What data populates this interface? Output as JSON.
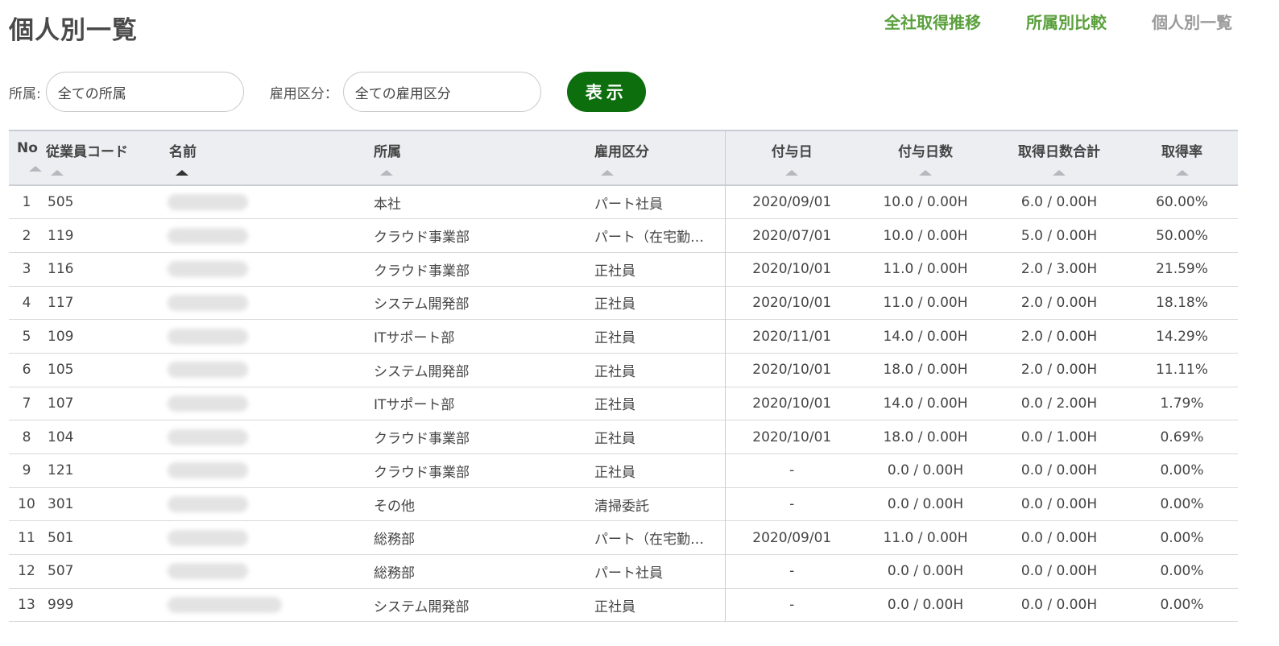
{
  "header": {
    "title": "個人別一覧",
    "nav": [
      {
        "label": "全社取得推移",
        "current": false
      },
      {
        "label": "所属別比較",
        "current": false
      },
      {
        "label": "個人別一覧",
        "current": true
      }
    ]
  },
  "filters": {
    "affiliation_label": "所属:",
    "affiliation_value": "全ての所属",
    "employment_label": "雇用区分：",
    "employment_value": "全ての雇用区分",
    "show_button": "表示"
  },
  "table": {
    "columns": [
      "No",
      "従業員コード",
      "名前",
      "所属",
      "雇用区分",
      "付与日",
      "付与日数",
      "取得日数合計",
      "取得率"
    ],
    "sorted_column": "名前",
    "rows": [
      {
        "no": "1",
        "code": "505",
        "affiliation": "本社",
        "employment": "パート社員",
        "grant_date": "2020/09/01",
        "grant_days": "10.0 / 0.00H",
        "taken_total": "6.0 / 0.00H",
        "rate": "60.00%"
      },
      {
        "no": "2",
        "code": "119",
        "affiliation": "クラウド事業部",
        "employment": "パート（在宅勤…",
        "grant_date": "2020/07/01",
        "grant_days": "10.0 / 0.00H",
        "taken_total": "5.0 / 0.00H",
        "rate": "50.00%"
      },
      {
        "no": "3",
        "code": "116",
        "affiliation": "クラウド事業部",
        "employment": "正社員",
        "grant_date": "2020/10/01",
        "grant_days": "11.0 / 0.00H",
        "taken_total": "2.0 / 3.00H",
        "rate": "21.59%"
      },
      {
        "no": "4",
        "code": "117",
        "affiliation": "システム開発部",
        "employment": "正社員",
        "grant_date": "2020/10/01",
        "grant_days": "11.0 / 0.00H",
        "taken_total": "2.0 / 0.00H",
        "rate": "18.18%"
      },
      {
        "no": "5",
        "code": "109",
        "affiliation": "ITサポート部",
        "employment": "正社員",
        "grant_date": "2020/11/01",
        "grant_days": "14.0 / 0.00H",
        "taken_total": "2.0 / 0.00H",
        "rate": "14.29%"
      },
      {
        "no": "6",
        "code": "105",
        "affiliation": "システム開発部",
        "employment": "正社員",
        "grant_date": "2020/10/01",
        "grant_days": "18.0 / 0.00H",
        "taken_total": "2.0 / 0.00H",
        "rate": "11.11%"
      },
      {
        "no": "7",
        "code": "107",
        "affiliation": "ITサポート部",
        "employment": "正社員",
        "grant_date": "2020/10/01",
        "grant_days": "14.0 / 0.00H",
        "taken_total": "0.0 / 2.00H",
        "rate": "1.79%"
      },
      {
        "no": "8",
        "code": "104",
        "affiliation": "クラウド事業部",
        "employment": "正社員",
        "grant_date": "2020/10/01",
        "grant_days": "18.0 / 0.00H",
        "taken_total": "0.0 / 1.00H",
        "rate": "0.69%"
      },
      {
        "no": "9",
        "code": "121",
        "affiliation": "クラウド事業部",
        "employment": "正社員",
        "grant_date": "-",
        "grant_days": "0.0 / 0.00H",
        "taken_total": "0.0 / 0.00H",
        "rate": "0.00%"
      },
      {
        "no": "10",
        "code": "301",
        "affiliation": "その他",
        "employment": "清掃委託",
        "grant_date": "-",
        "grant_days": "0.0 / 0.00H",
        "taken_total": "0.0 / 0.00H",
        "rate": "0.00%"
      },
      {
        "no": "11",
        "code": "501",
        "affiliation": "総務部",
        "employment": "パート（在宅勤…",
        "grant_date": "2020/09/01",
        "grant_days": "11.0 / 0.00H",
        "taken_total": "0.0 / 0.00H",
        "rate": "0.00%"
      },
      {
        "no": "12",
        "code": "507",
        "affiliation": "総務部",
        "employment": "パート社員",
        "grant_date": "-",
        "grant_days": "0.0 / 0.00H",
        "taken_total": "0.0 / 0.00H",
        "rate": "0.00%"
      },
      {
        "no": "13",
        "code": "999",
        "affiliation": "システム開発部",
        "employment": "正社員",
        "grant_date": "-",
        "grant_days": "0.0 / 0.00H",
        "taken_total": "0.0 / 0.00H",
        "rate": "0.00%"
      }
    ]
  },
  "colors": {
    "nav_link": "#5aa03c",
    "nav_current": "#9a9a9a",
    "show_button_bg": "#0d6e0d",
    "header_bg": "#eceef1"
  }
}
